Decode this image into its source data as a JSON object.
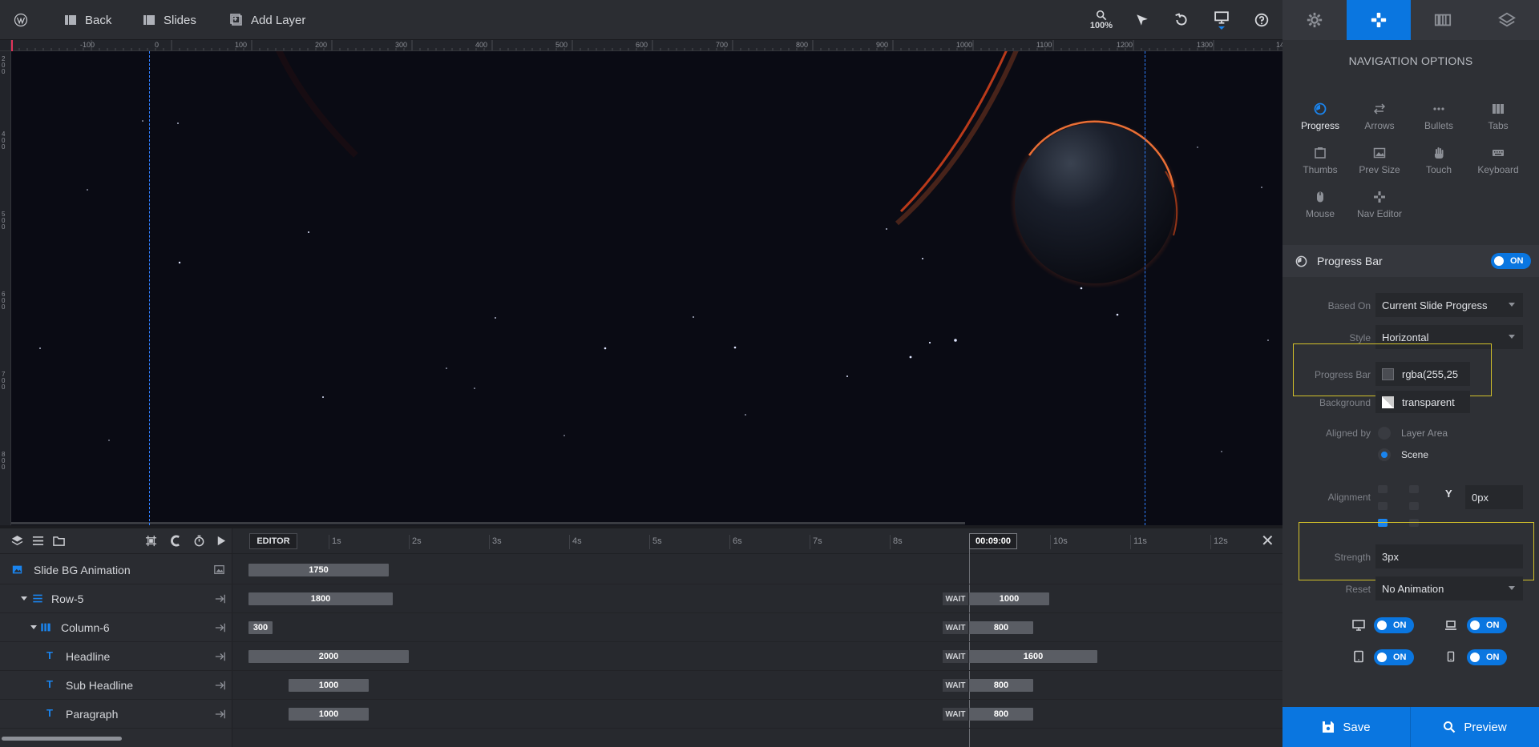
{
  "topbar": {
    "back_label": "Back",
    "slides_label": "Slides",
    "add_layer_label": "Add Layer",
    "zoom_level": "100%"
  },
  "ruler": {
    "h_labels": [
      "-100",
      "0",
      "100",
      "200",
      "300",
      "400",
      "500",
      "600",
      "700",
      "800",
      "900",
      "1000",
      "1100",
      "1200",
      "1300",
      "14"
    ],
    "v_labels": [
      "200",
      "400",
      "500",
      "600",
      "700",
      "800"
    ]
  },
  "panel": {
    "title": "NAVIGATION OPTIONS",
    "nav_items": [
      "Progress",
      "Arrows",
      "Bullets",
      "Tabs",
      "Thumbs",
      "Prev Size",
      "Touch",
      "Keyboard",
      "Mouse",
      "Nav Editor"
    ],
    "active_nav": "Progress",
    "section_title": "Progress Bar",
    "section_toggle": "ON",
    "based_on_label": "Based On",
    "based_on_value": "Current Slide Progress",
    "style_label": "Style",
    "style_value": "Horizontal",
    "progress_bar_label": "Progress Bar",
    "progress_bar_value": "rgba(255,25",
    "background_label": "Background",
    "background_value": "transparent",
    "aligned_by_label": "Aligned by",
    "aligned_opt_1": "Layer Area",
    "aligned_opt_2": "Scene",
    "aligned_selected": "Scene",
    "alignment_label": "Alignment",
    "alignment_y_value": "0px",
    "y_label": "Y",
    "strength_label": "Strength",
    "strength_value": "3px",
    "reset_label": "Reset",
    "reset_value": "No Animation",
    "device_toggles": [
      "ON",
      "ON",
      "ON",
      "ON"
    ],
    "save_label": "Save",
    "preview_label": "Preview"
  },
  "timeline": {
    "editor_label": "EDITOR",
    "ticks": [
      "1s",
      "2s",
      "3s",
      "4s",
      "5s",
      "6s",
      "7s",
      "8s",
      "9s",
      "10s",
      "11s",
      "12s"
    ],
    "current_time": "00:09:00",
    "wait_label": "WAIT",
    "layers": [
      {
        "name": "Slide BG Animation",
        "bar1": "1750",
        "bar2": ""
      },
      {
        "name": "Row-5",
        "bar1": "1800",
        "bar2": "1000"
      },
      {
        "name": "Column-6",
        "bar1": "300",
        "bar2": "800"
      },
      {
        "name": "Headline",
        "bar1": "2000",
        "bar2": "1600"
      },
      {
        "name": "Sub Headline",
        "bar1": "1000",
        "bar2": "800"
      },
      {
        "name": "Paragraph",
        "bar1": "1000",
        "bar2": "800"
      }
    ]
  },
  "colors": {
    "accent": "#0a76e0",
    "highlight": "#d4c22a",
    "planet_glow": "#ff5a1f"
  }
}
